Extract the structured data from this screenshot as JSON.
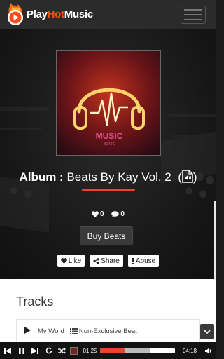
{
  "header": {
    "logo_play": "Play",
    "logo_hot": "Hot",
    "logo_music": "Music"
  },
  "album": {
    "label": "Album :",
    "name": "Beats By Kay Vol. 2",
    "paren_open": "(",
    "paren_close": ")",
    "cover_text": "MUSIC",
    "cover_subtext": "BEATS"
  },
  "stats": {
    "likes": "0",
    "comments": "0"
  },
  "buttons": {
    "buy": "Buy Beats",
    "like": "Like",
    "share": "Share",
    "abuse": "Abuse"
  },
  "tracks": {
    "title": "Tracks",
    "items": [
      {
        "name": "My Word",
        "license": "Non-Exclusive Beat"
      }
    ]
  },
  "player": {
    "current_time": "01:25",
    "duration": "04:18",
    "progress": 0.33,
    "buffered": 0.67
  },
  "colors": {
    "accent": "#e8452e",
    "logo_hot": "#ff4a1c",
    "background": "#1b1b1b"
  }
}
